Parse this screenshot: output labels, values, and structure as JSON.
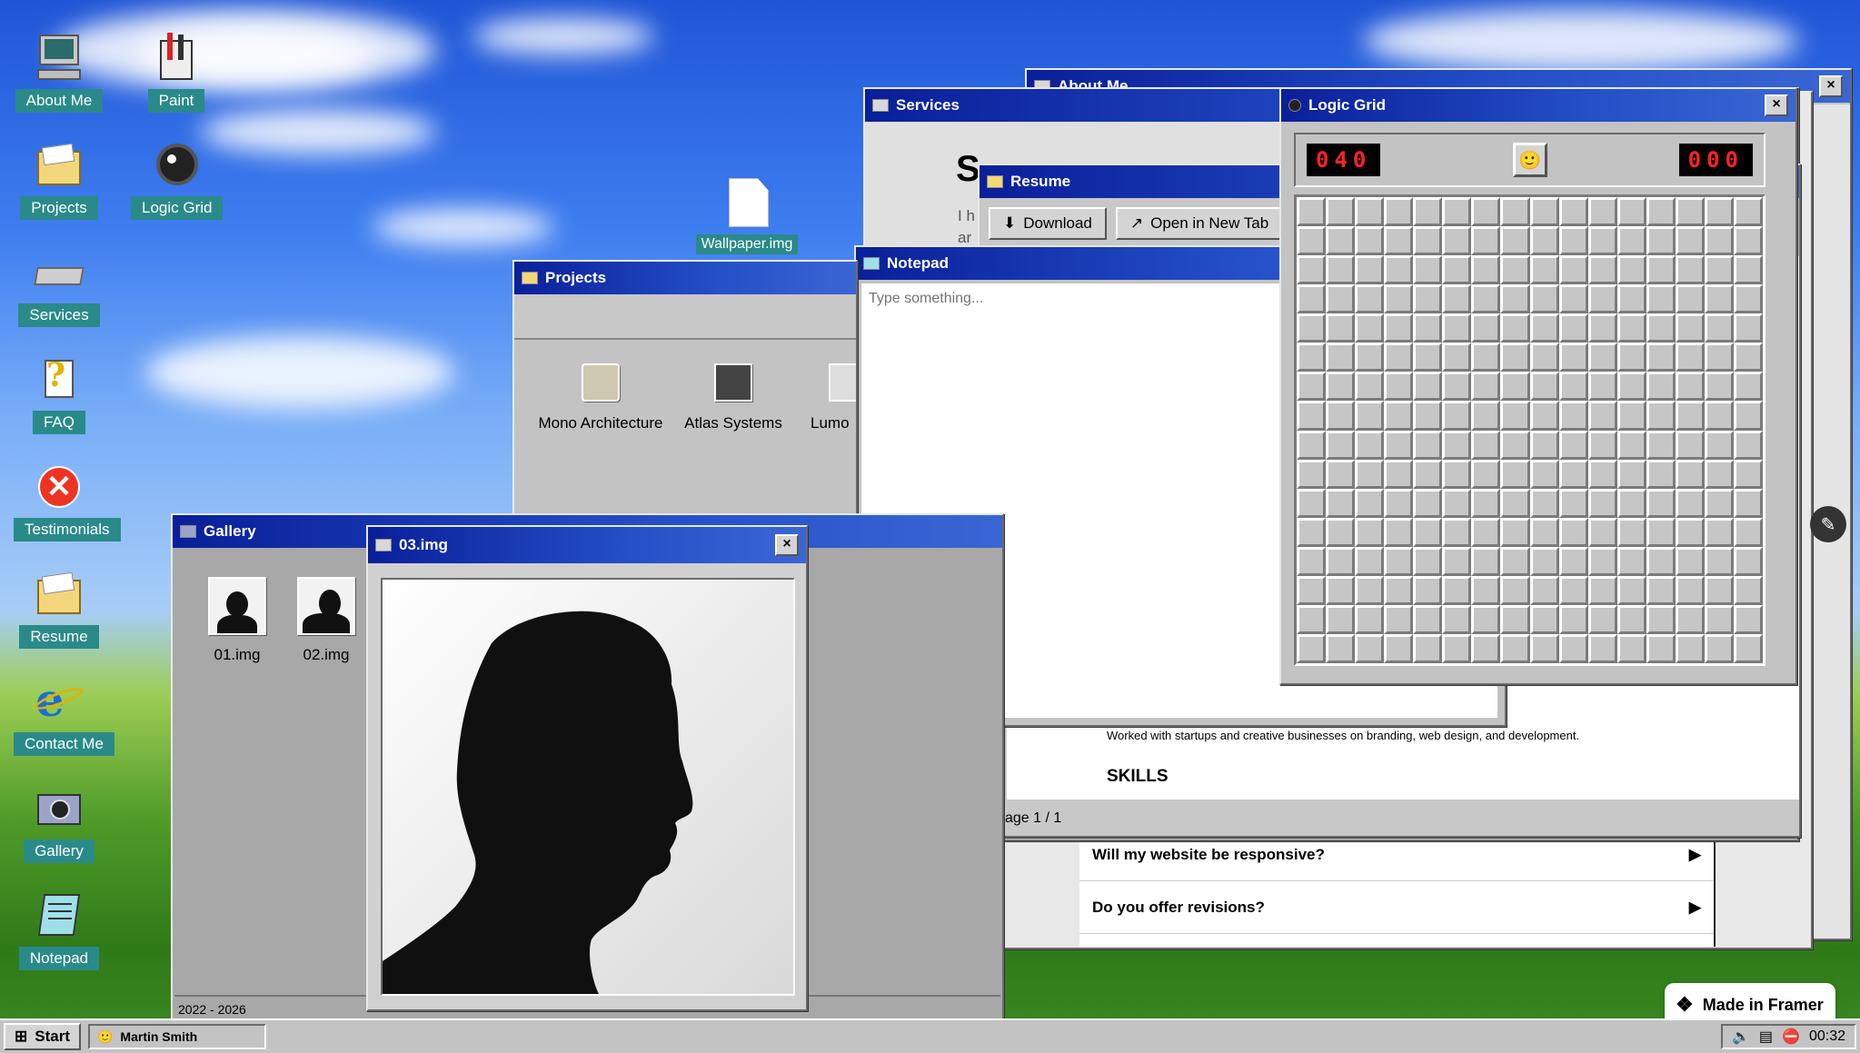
{
  "desktop": {
    "icons": [
      {
        "label": "About Me",
        "icon": "computer-icon"
      },
      {
        "label": "Paint",
        "icon": "paint-icon"
      },
      {
        "label": "Projects",
        "icon": "folder-icon"
      },
      {
        "label": "Logic Grid",
        "icon": "mine-icon"
      },
      {
        "label": "Services",
        "icon": "drive-icon"
      },
      {
        "label": "FAQ",
        "icon": "help-icon"
      },
      {
        "label": "Testimonials",
        "icon": "error-icon"
      },
      {
        "label": "Resume",
        "icon": "folder-icon"
      },
      {
        "label": "Contact Me",
        "icon": "browser-icon"
      },
      {
        "label": "Gallery",
        "icon": "camera-icon"
      },
      {
        "label": "Notepad",
        "icon": "notepad-icon"
      },
      {
        "label": "Wallpaper.img",
        "icon": "file-icon"
      }
    ]
  },
  "windows": {
    "about": {
      "title": "About Me"
    },
    "services": {
      "title": "Services",
      "heading_fragment": "S",
      "body_fragment": "I h",
      "body_fragment2": "ar"
    },
    "resume": {
      "title": "Resume",
      "download": "Download",
      "open_tab": "Open in New Tab",
      "experience_text": "Worked with startups and creative businesses on branding, web design, and development.",
      "skills_heading": "SKILLS",
      "page_indicator": "age 1 / 1"
    },
    "faq": {
      "q1": "Will my website be responsive?",
      "q2": "Do you offer revisions?",
      "arrow": "▶"
    },
    "notepad": {
      "title": "Notepad",
      "placeholder": "Type something..."
    },
    "projects": {
      "title": "Projects",
      "items": [
        {
          "label": "Mono Architecture"
        },
        {
          "label": "Atlas Systems"
        },
        {
          "label": "Lumo"
        }
      ]
    },
    "gallery": {
      "title": "Gallery",
      "items": [
        {
          "label": "01.img"
        },
        {
          "label": "02.img"
        }
      ],
      "footer": "2022 - 2026"
    },
    "image_viewer": {
      "title": "03.img",
      "close": "×"
    },
    "logic_grid": {
      "title": "Logic Grid",
      "mines_counter": "040",
      "timer": "000",
      "face": "🙂",
      "close": "×"
    }
  },
  "taskbar": {
    "start_label": "Start",
    "task_label": "Martin Smith",
    "clock": "00:32"
  },
  "badge": {
    "label": "Made in Framer"
  }
}
